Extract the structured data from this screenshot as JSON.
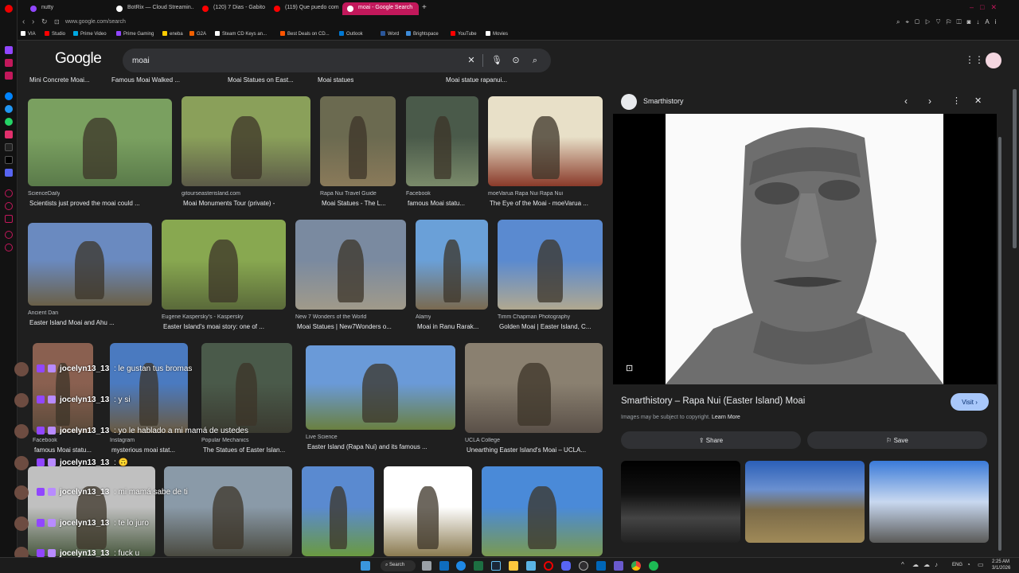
{
  "browser": {
    "tabs": [
      {
        "label": "nutty",
        "active": false,
        "color": "#9146ff"
      },
      {
        "label": "BotRix — Cloud Streamin...",
        "active": false,
        "color": "#ffffff"
      },
      {
        "label": "(120) 7 Dias - Gabito Balle...",
        "active": false,
        "color": "#ff0000"
      },
      {
        "label": "(119) Que puedo compra...",
        "active": false,
        "color": "#ff0000"
      },
      {
        "label": "moai - Google Search",
        "active": true,
        "color": "#ffffff"
      }
    ],
    "url": "www.google.com/search",
    "bookmarks": [
      {
        "label": "VIA",
        "color": "#ffffff"
      },
      {
        "label": "Studio",
        "color": "#ff0000"
      },
      {
        "label": "Prime Video",
        "color": "#00a8e1"
      },
      {
        "label": "Prime Gaming",
        "color": "#9146ff"
      },
      {
        "label": "eneba",
        "color": "#ffcc00"
      },
      {
        "label": "G2A",
        "color": "#f05f00"
      },
      {
        "label": "Steam CD Keys an...",
        "color": "#ffffff"
      },
      {
        "label": "Best Deals on CD...",
        "color": "#ff5500"
      },
      {
        "label": "Outlook",
        "color": "#0078d4"
      },
      {
        "label": "Word",
        "color": "#2b579a"
      },
      {
        "label": "Brightspace",
        "color": "#3d8bd9"
      },
      {
        "label": "YouTube",
        "color": "#ff0000"
      },
      {
        "label": "Movies",
        "color": "#ffffff"
      }
    ]
  },
  "google": {
    "logo": "Google",
    "query": "moai",
    "top_row": [
      "Mini Concrete Moai...",
      "Famous Moai  Walked ...",
      "Moai Statues on East...",
      "Moai statues",
      "Moai statue rapanui..."
    ]
  },
  "results": [
    {
      "source": "ScienceDaily",
      "title": "Scientists just proved the moai could ...",
      "c1": "#7aa060",
      "c2": "#5a7a4a"
    },
    {
      "source": "gitourseasterisland.com",
      "title": "Moai Monuments Tour (private) -",
      "c1": "#8aa05a",
      "c2": "#5c5a48"
    },
    {
      "source": "Rapa Nui Travel Guide",
      "title": "Moai Statues - The L...",
      "c1": "#6b6a50",
      "c2": "#8a7a5a"
    },
    {
      "source": "Facebook",
      "title": "famous Moai statu...",
      "c1": "#4a5a4a",
      "c2": "#7a8a6a"
    },
    {
      "source": "moeVarua Rapa Nui Rapa Nui",
      "title": "The Eye of the Moai - moeVarua ...",
      "c1": "#e8e0c8",
      "c2": "#8a3a2a"
    },
    {
      "source": "Ancient Dan",
      "title": "Easter Island Moai and Ahu ...",
      "c1": "#6a8ac0",
      "c2": "#6a6048"
    },
    {
      "source": "Eugene Kaspersky's - Kaspersky",
      "title": "Easter Island's moai story: one of ...",
      "c1": "#88a850",
      "c2": "#5a6a3a"
    },
    {
      "source": "New 7 Wonders of the World",
      "title": "Moai Statues | New7Wonders o...",
      "c1": "#7a8aa0",
      "c2": "#a09a8a"
    },
    {
      "source": "Alamy",
      "title": "Moai in Ranu Rarak...",
      "c1": "#6aa0d8",
      "c2": "#7a6a50"
    },
    {
      "source": "Timm Chapman Photography",
      "title": "Golden Moai | Easter Island, C...",
      "c1": "#5a8ad0",
      "c2": "#b0a890"
    },
    {
      "source": "Facebook",
      "title": "famous Moai statu...",
      "c1": "#8a6050",
      "c2": "#5a4a3a"
    },
    {
      "source": "Instagram",
      "title": "mysterious moai stat...",
      "c1": "#4a7ac0",
      "c2": "#6a5a40"
    },
    {
      "source": "Popular Mechanics",
      "title": "The Statues of Easter Islan...",
      "c1": "#4a5a4a",
      "c2": "#3a3a30"
    },
    {
      "source": "Live Science",
      "title": "Easter Island (Rapa Nui) and its famous ...",
      "c1": "#6a9ad8",
      "c2": "#6a8040"
    },
    {
      "source": "UCLA College",
      "title": "Unearthing Easter Island's Moai – UCLA...",
      "c1": "#8a8070",
      "c2": "#5a5048"
    },
    {
      "source": "",
      "title": "",
      "c1": "#c0c0c0",
      "c2": "#4a5a40"
    },
    {
      "source": "",
      "title": "",
      "c1": "#8a9aa8",
      "c2": "#4a4a40"
    },
    {
      "source": "",
      "title": "",
      "c1": "#5a8ad0",
      "c2": "#6a9a40"
    },
    {
      "source": "",
      "title": "",
      "c1": "#ffffff",
      "c2": "#8a7a50"
    },
    {
      "source": "",
      "title": "",
      "c1": "#4a8ad8",
      "c2": "#7a9a50"
    }
  ],
  "panel": {
    "source": "Smarthistory",
    "title": "Smarthistory – Rapa Nui (Easter Island) Moai",
    "visit": "Visit",
    "copyright": "Images may be subject to copyright.",
    "learn_more": "Learn More",
    "share": "Share",
    "save": "Save"
  },
  "chat": [
    {
      "user": "jocelyn13_13",
      "msg": ": le gustan tus bromas"
    },
    {
      "user": "jocelyn13_13",
      "msg": ": y si"
    },
    {
      "user": "jocelyn13_13",
      "msg": ": yo le hablado a mi mamá de ustedes"
    },
    {
      "user": "jocelyn13_13",
      "msg": ": 🙃"
    },
    {
      "user": "jocelyn13_13",
      "msg": ": mi mamá sabe de ti"
    },
    {
      "user": "jocelyn13_13",
      "msg": ": te lo juro"
    },
    {
      "user": "jocelyn13_13",
      "msg": ": fuck u"
    }
  ],
  "taskbar": {
    "search": "Search",
    "lang": "ENG",
    "time": "2:25 AM",
    "date": "3/1/2026"
  },
  "colors": {
    "accent": "#c2185b",
    "visit_button": "#a8c7fa",
    "pill": "#303134"
  }
}
